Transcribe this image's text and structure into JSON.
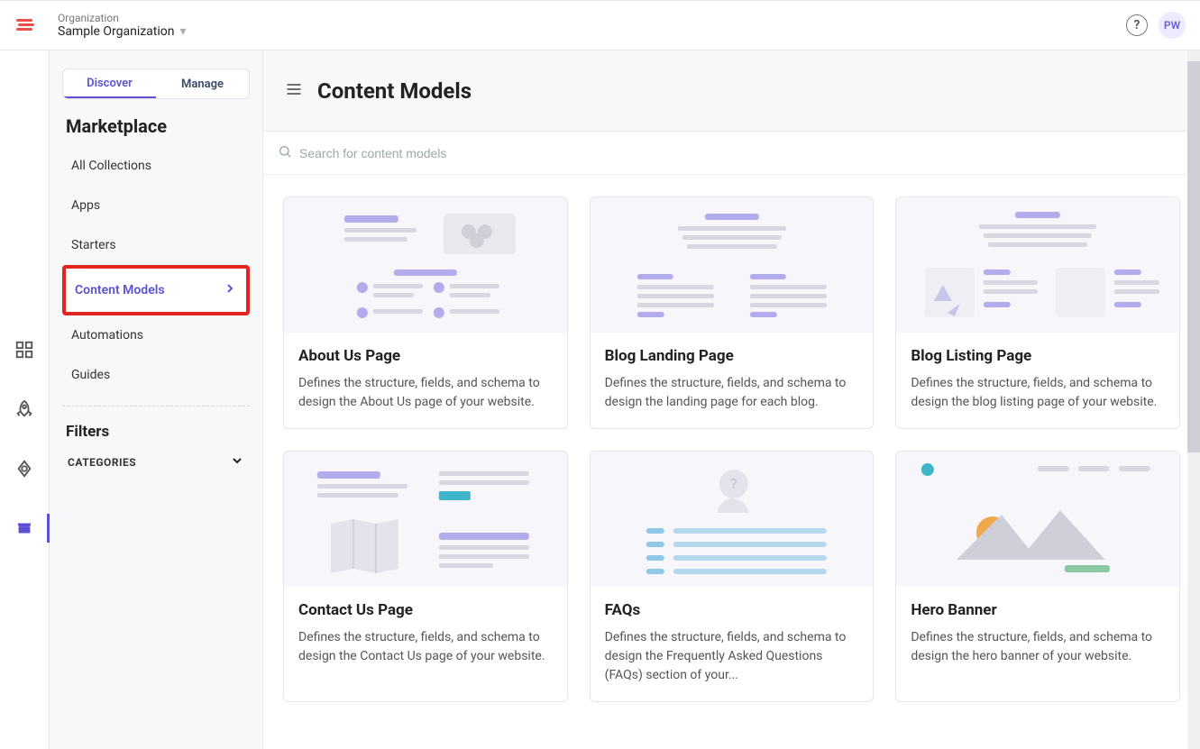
{
  "header": {
    "org_label": "Organization",
    "org_name": "Sample Organization",
    "avatar_initials": "PW"
  },
  "sidebar": {
    "tabs": {
      "discover": "Discover",
      "manage": "Manage"
    },
    "heading": "Marketplace",
    "items": [
      {
        "label": "All Collections"
      },
      {
        "label": "Apps"
      },
      {
        "label": "Starters"
      },
      {
        "label": "Content Models",
        "selected": true,
        "highlighted": true
      },
      {
        "label": "Automations"
      },
      {
        "label": "Guides"
      }
    ],
    "filters_heading": "Filters",
    "filters_categories_label": "CATEGORIES"
  },
  "main": {
    "page_title": "Content Models",
    "search_placeholder": "Search for content models"
  },
  "cards": [
    {
      "title": "About Us Page",
      "desc": "Defines the structure, fields, and schema to design the About Us page of your website."
    },
    {
      "title": "Blog Landing Page",
      "desc": "Defines the structure, fields, and schema to design the landing page for each blog."
    },
    {
      "title": "Blog Listing Page",
      "desc": "Defines the structure, fields, and schema to design the blog listing page of your website."
    },
    {
      "title": "Contact Us Page",
      "desc": "Defines the structure, fields, and schema to design the Contact Us page of your website."
    },
    {
      "title": "FAQs",
      "desc": "Defines the structure, fields, and schema to design the Frequently Asked Questions (FAQs) section of your..."
    },
    {
      "title": "Hero Banner",
      "desc": "Defines the structure, fields, and schema to design the hero banner of your website."
    }
  ]
}
